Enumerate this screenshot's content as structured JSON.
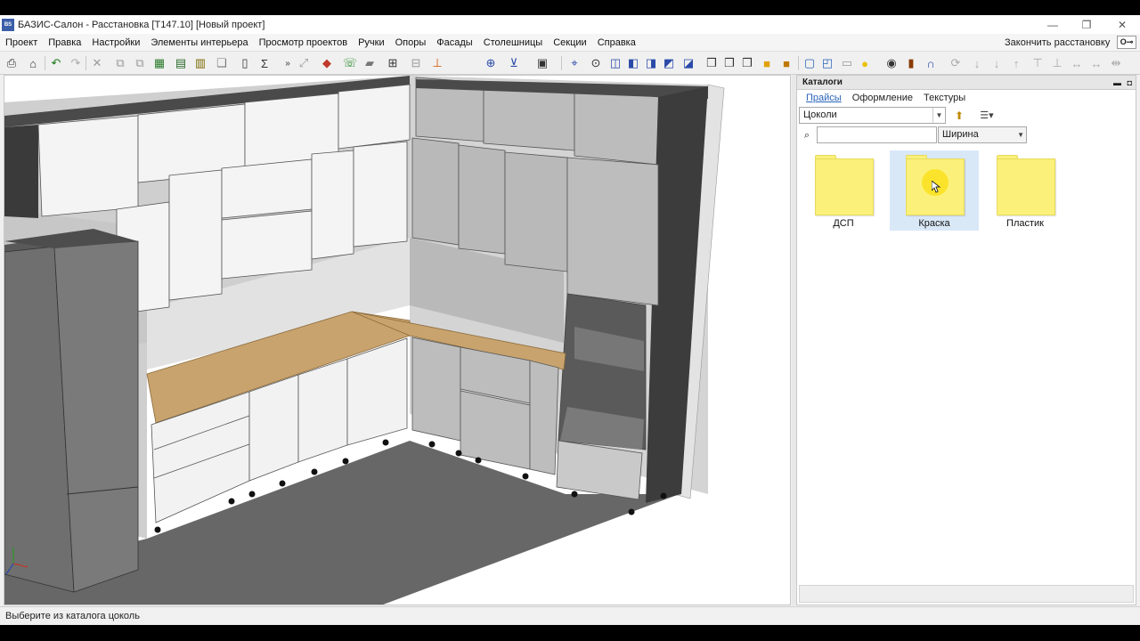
{
  "window": {
    "app_icon": "BS",
    "title": "БАЗИС-Салон  -  Расстановка [Т147.10] [Новый проект]",
    "minimize": "—",
    "maximize": "❐",
    "close": "✕"
  },
  "menu": {
    "items": [
      "Проект",
      "Правка",
      "Настройки",
      "Элементы интерьера",
      "Просмотр проектов",
      "Ручки",
      "Опоры",
      "Фасады",
      "Столешницы",
      "Секции",
      "Справка"
    ],
    "finish": "Закончить расстановку",
    "key_badge": "О⊸"
  },
  "catalog": {
    "title": "Каталоги",
    "pin": "▬",
    "close": "◘",
    "tabs": [
      "Прайсы",
      "Оформление",
      "Текстуры"
    ],
    "active_tab": 0,
    "type_value": "Цоколи",
    "search_value": "",
    "sort_value": "Ширина",
    "folders": [
      {
        "label": "ДСП",
        "selected": false
      },
      {
        "label": "Краска",
        "selected": true
      },
      {
        "label": "Пластик",
        "selected": false
      }
    ]
  },
  "status": {
    "text": "Выберите из каталога цоколь"
  },
  "colors": {
    "folder": "#fbf17a",
    "selection": "#d9e8f7",
    "active_tab": "#2a63b8",
    "countertop": "#c9a36e",
    "cabinet_front": "#f2f2f2",
    "cabinet_grey": "#bdbdbd",
    "floor": "#666666"
  }
}
